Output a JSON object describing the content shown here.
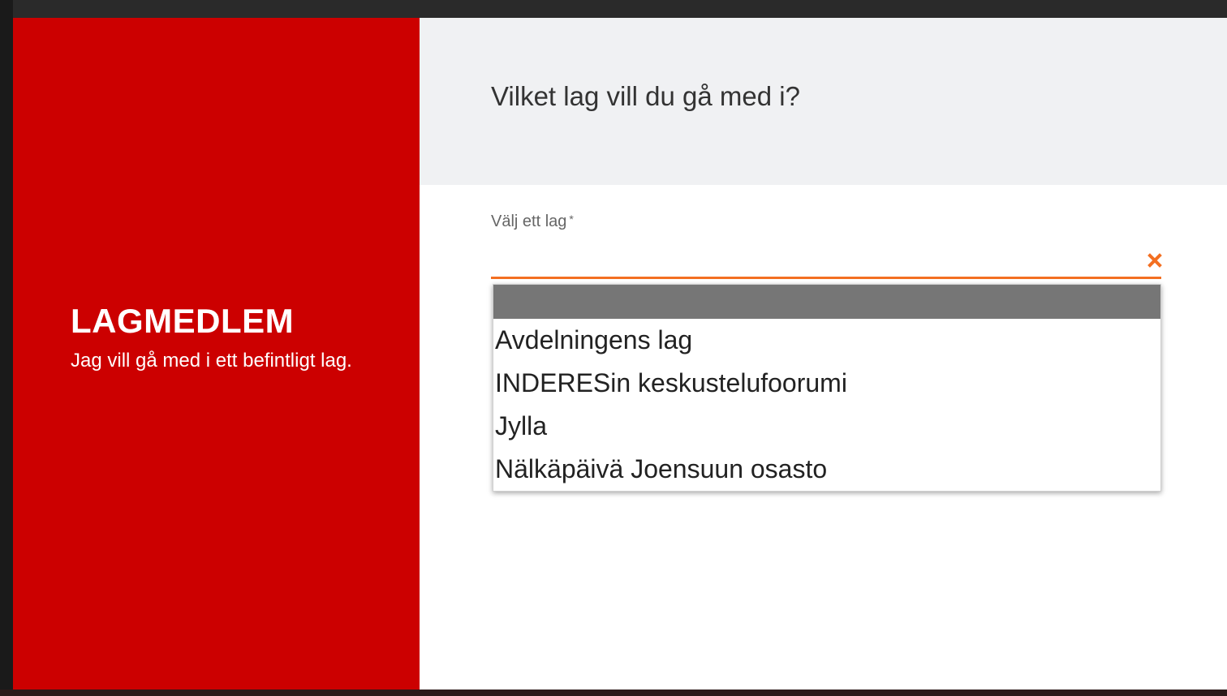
{
  "join_panel": {
    "title": "LAGMEDLEM",
    "description": "Jag vill gå med i ett befintligt lag."
  },
  "form": {
    "question": "Vilket lag vill du gå med i?",
    "field_label": "Välj ett lag",
    "required_marker": "*",
    "selected_value": "",
    "options": [
      "",
      "Avdelningens lag",
      "INDERESin keskustelufoorumi",
      "Jylla",
      "Nälkäpäivä Joensuun osasto"
    ]
  },
  "colors": {
    "brand_red": "#cc0000",
    "accent_orange": "#f36f21",
    "highlight_gray": "#767676"
  }
}
